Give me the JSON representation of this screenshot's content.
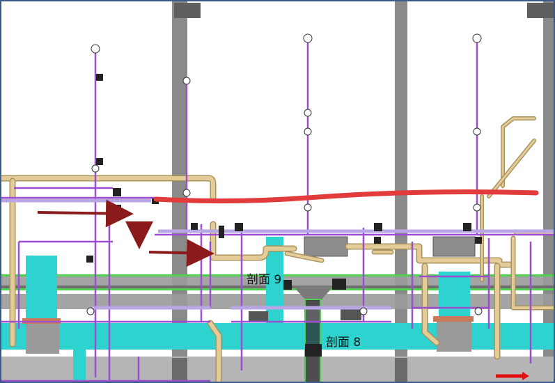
{
  "drawing": {
    "section_labels": [
      {
        "id": "section-9",
        "text": "剖面 9"
      },
      {
        "id": "section-8",
        "text": "剖面 8"
      }
    ]
  },
  "colors": {
    "background": "#ffffff",
    "column": "#8a8a8a",
    "beam": "#9a9a9a",
    "beam_dark": "#6f6f6f",
    "pipe_tan": "#d9c08a",
    "pipe_tan_edge": "#a8925e",
    "pipe_purple": "#9b4fd0",
    "pipe_lavender": "#b9a6e6",
    "duct_cyan": "#2ed3cf",
    "duct_green": "#4fd24f",
    "equipment_gray": "#9a9a9a",
    "markup_red": "#e23b3b",
    "arrow_darkred": "#8b1a1a",
    "arrow_red": "#e01010",
    "frame": "#3a5a8a"
  }
}
